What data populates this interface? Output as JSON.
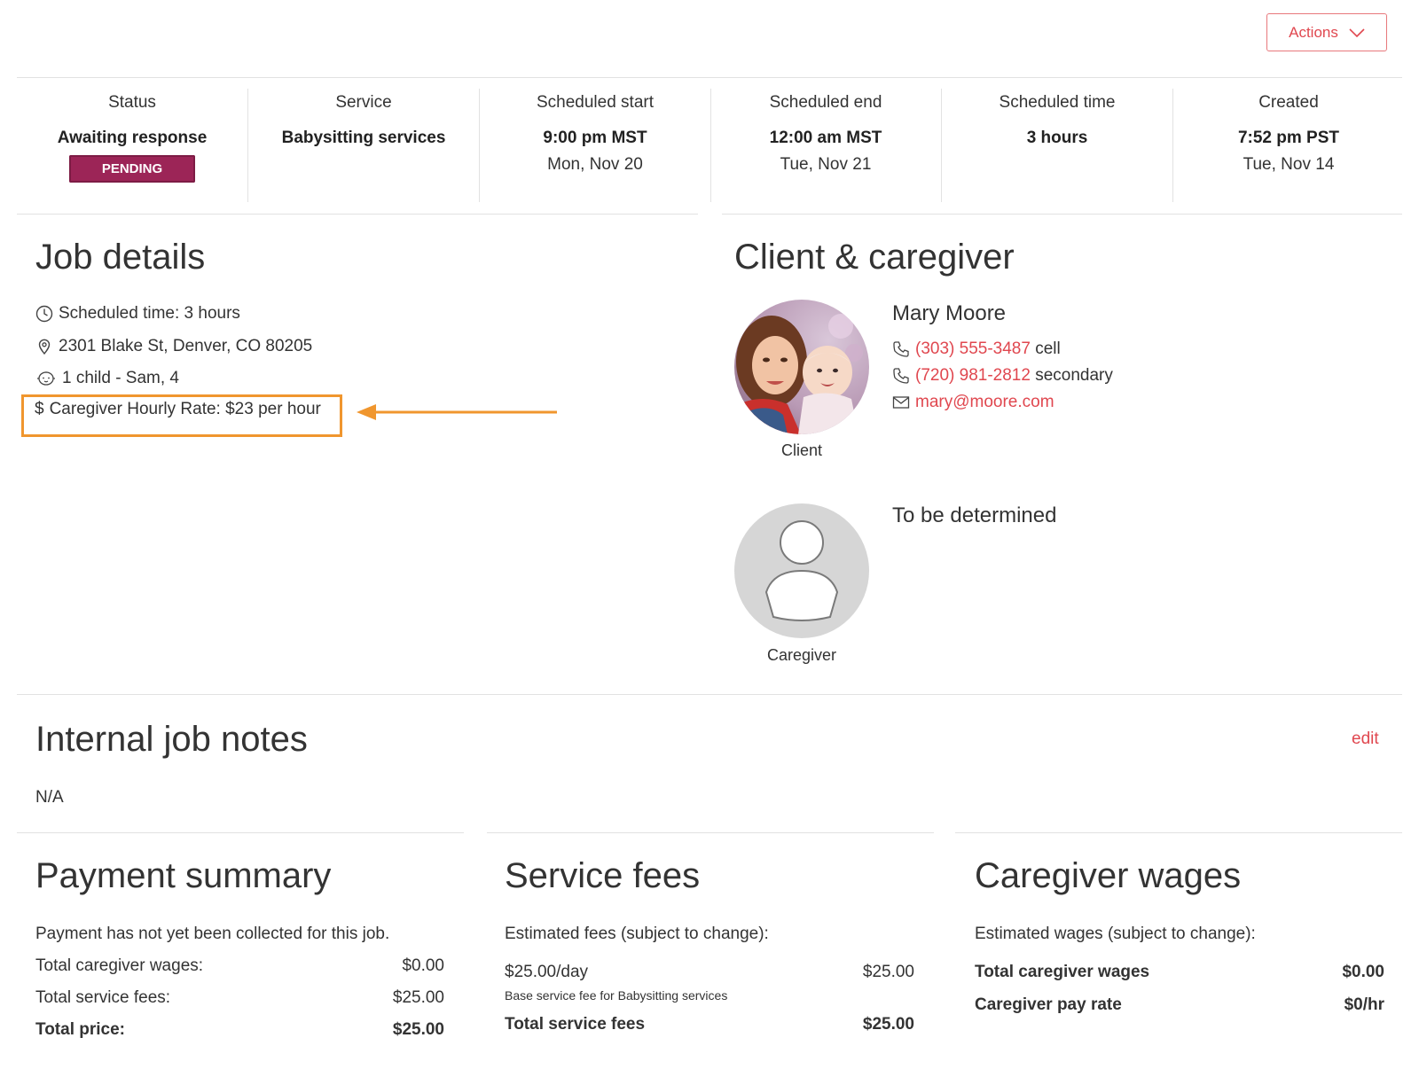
{
  "header": {
    "actions_label": "Actions"
  },
  "status_strip": [
    {
      "label": "Status",
      "value": "Awaiting response",
      "badge": "PENDING"
    },
    {
      "label": "Service",
      "value": "Babysitting services"
    },
    {
      "label": "Scheduled start",
      "value": "9:00 pm MST",
      "sub": "Mon, Nov 20"
    },
    {
      "label": "Scheduled end",
      "value": "12:00 am MST",
      "sub": "Tue, Nov 21"
    },
    {
      "label": "Scheduled time",
      "value": "3 hours"
    },
    {
      "label": "Created",
      "value": "7:52 pm PST",
      "sub": "Tue, Nov 14"
    }
  ],
  "job_details": {
    "title": "Job details",
    "scheduled_time": "Scheduled time: 3 hours",
    "address": "2301 Blake St, Denver, CO 80205",
    "children": "1 child - Sam, 4",
    "rate_symbol": "$",
    "rate": "Caregiver Hourly Rate: $23 per hour"
  },
  "client_caregiver": {
    "title": "Client & caregiver",
    "client": {
      "name": "Mary Moore",
      "caption": "Client",
      "phone1": "(303) 555-3487",
      "phone1_type": "cell",
      "phone2": "(720) 981-2812",
      "phone2_type": "secondary",
      "email": "mary@moore.com"
    },
    "caregiver": {
      "name": "To be determined",
      "caption": "Caregiver"
    }
  },
  "notes": {
    "title": "Internal job notes",
    "edit_label": "edit",
    "value": "N/A"
  },
  "payment_summary": {
    "title": "Payment summary",
    "note": "Payment has not yet been collected for this job.",
    "rows": [
      {
        "label": "Total caregiver wages:",
        "value": "$0.00"
      },
      {
        "label": "Total service fees:",
        "value": "$25.00"
      },
      {
        "label": "Total price:",
        "value": "$25.00"
      }
    ]
  },
  "service_fees": {
    "title": "Service fees",
    "note": "Estimated fees (subject to change):",
    "fee_label": "$25.00/day",
    "fee_value": "$25.00",
    "fee_desc": "Base service fee for Babysitting services",
    "total_label": "Total service fees",
    "total_value": "$25.00"
  },
  "caregiver_wages": {
    "title": "Caregiver wages",
    "note": "Estimated wages (subject to change):",
    "rows": [
      {
        "label": "Total caregiver wages",
        "value": "$0.00"
      },
      {
        "label": "Caregiver pay rate",
        "value": "$0/hr"
      }
    ]
  },
  "colors": {
    "accent": "#e0474f",
    "badge": "#9c2557",
    "highlight": "#f0962e"
  }
}
